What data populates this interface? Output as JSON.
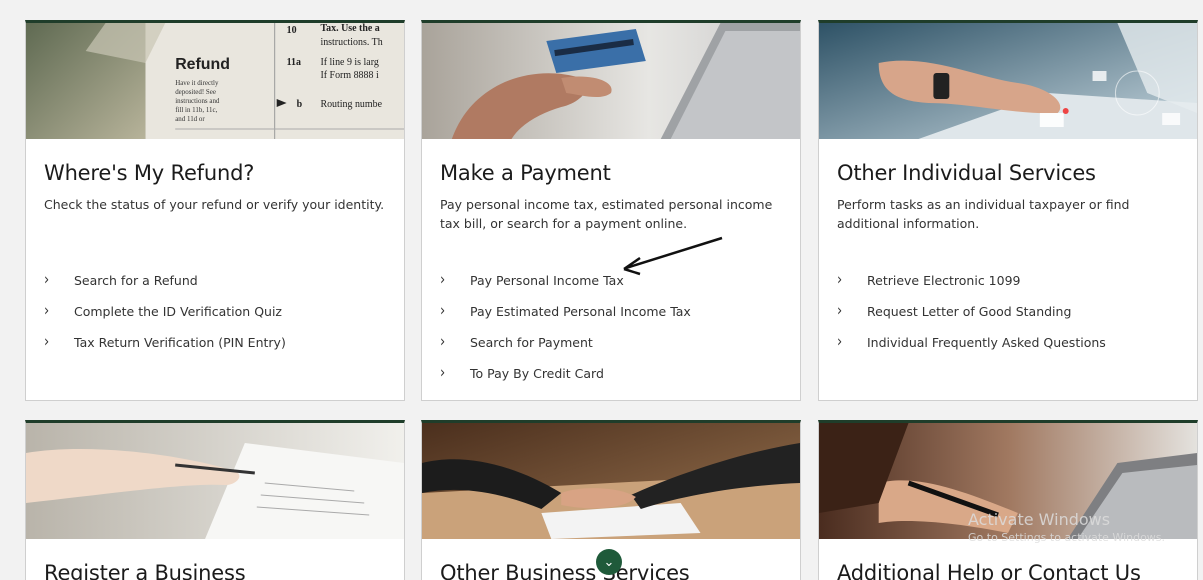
{
  "cards_top": [
    {
      "title": "Where's My Refund?",
      "description": "Check the status of your refund or verify your identity.",
      "links": [
        "Search for a Refund",
        "Complete the ID Verification Quiz",
        "Tax Return Verification (PIN Entry)"
      ]
    },
    {
      "title": "Make a Payment",
      "description": "Pay personal income tax, estimated personal income tax bill, or search for a payment online.",
      "links": [
        "Pay Personal Income Tax",
        "Pay Estimated Personal Income Tax",
        "Search for Payment",
        "To Pay By Credit Card"
      ]
    },
    {
      "title": "Other Individual Services",
      "description": "Perform tasks as an individual taxpayer or find additional information.",
      "links": [
        "Retrieve Electronic 1099",
        "Request Letter of Good Standing",
        "Individual Frequently Asked Questions"
      ]
    }
  ],
  "cards_bottom": [
    {
      "title": "Register a Business"
    },
    {
      "title": "Other Business Services"
    },
    {
      "title": "Additional Help or Contact Us"
    }
  ],
  "refund_image": {
    "heading": "Refund",
    "line_no_1": "10",
    "line_1": "Tax. Use the a",
    "line_1b": "instructions. Th",
    "line_no_2": "11a",
    "line_2": "If line 9 is larg",
    "line_2b": "If Form 8888 i",
    "line_no_3": "b",
    "line_3": "Routing numbe",
    "side_note": [
      "Have it directly",
      "deposited! See",
      "instructions and",
      "fill in 11b, 11c,",
      "and 11d or"
    ]
  },
  "watermark": {
    "line1": "Activate Windows",
    "line2": "Go to Settings to activate Windows."
  },
  "scroll_icon": "chevron-down-icon",
  "colors": {
    "card_accent": "#1f3d2a",
    "scroll_button": "#1f5a3a"
  }
}
